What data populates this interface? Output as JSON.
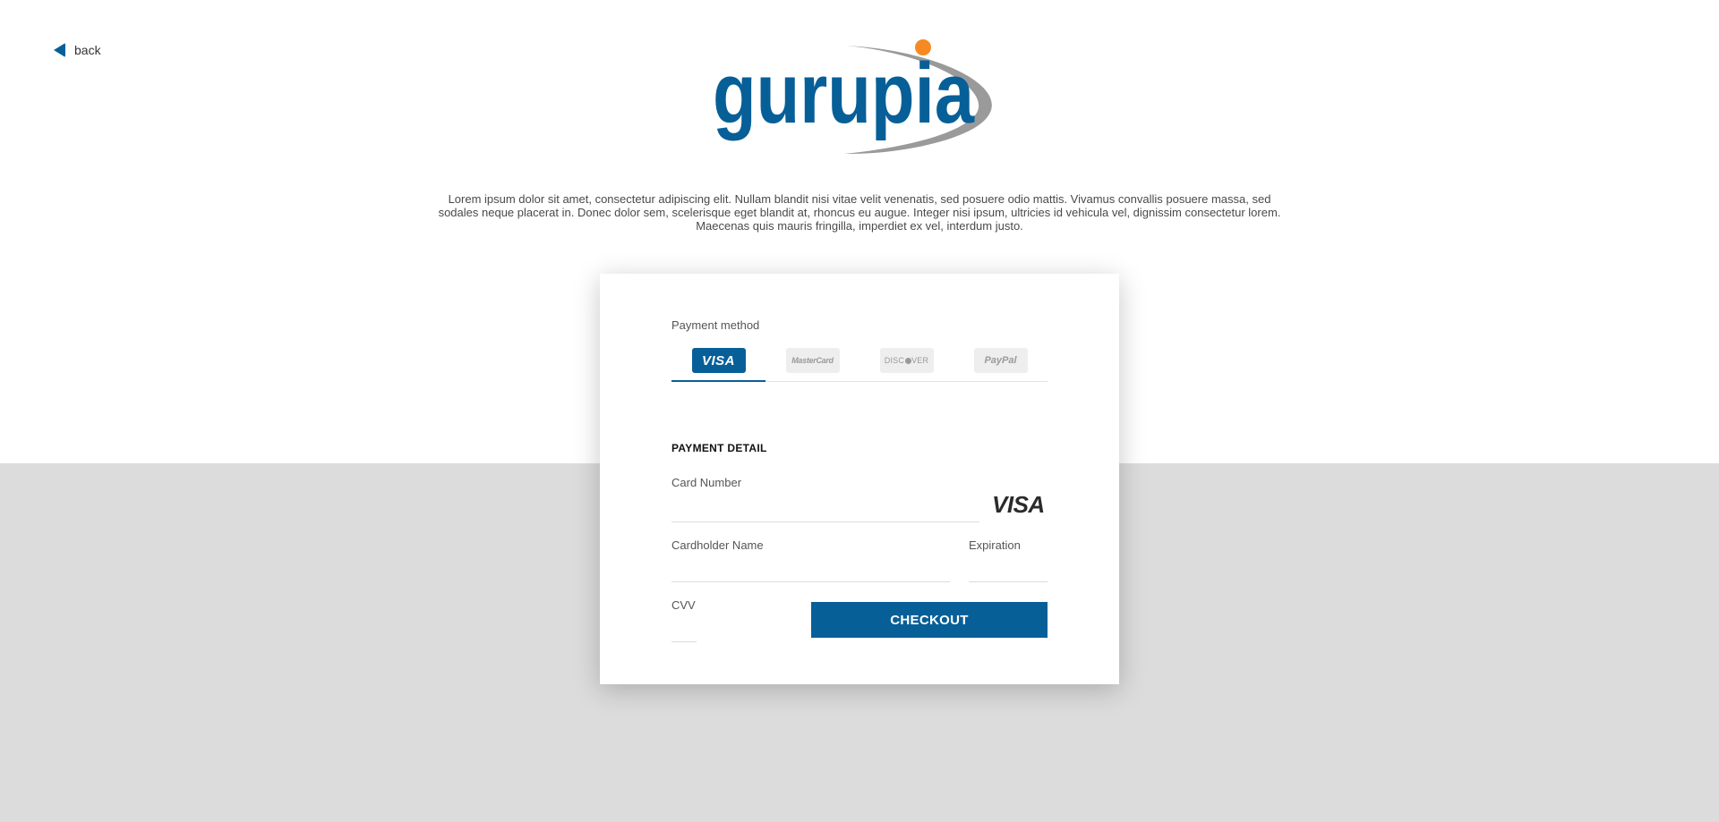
{
  "nav": {
    "back_label": "back"
  },
  "brand": {
    "logo_text": "gurupia",
    "primary_color": "#075f98",
    "accent_color": "#f58a25",
    "swoosh_color": "#9a9a9a"
  },
  "intro_text": "Lorem ipsum dolor sit amet, consectetur adipiscing elit. Nullam blandit nisi vitae velit venenatis, sed posuere odio mattis. Vivamus convallis posuere massa, sed sodales neque placerat in. Donec dolor sem, scelerisque eget blandit at, rhoncus eu augue. Integer nisi ipsum, ultricies id vehicula vel, dignissim consectetur lorem. Maecenas quis mauris fringilla, imperdiet ex vel, interdum justo.",
  "payment": {
    "method_label": "Payment method",
    "selected_method": "VISA",
    "methods": [
      {
        "label": "VISA",
        "icon": "visa-icon"
      },
      {
        "label": "MasterCard",
        "icon": "mastercard-icon"
      },
      {
        "label": "DISCOVER",
        "icon": "discover-icon"
      },
      {
        "label": "PayPal",
        "icon": "paypal-icon"
      }
    ],
    "detail_title": "PAYMENT DETAIL",
    "card_number_label": "Card Number",
    "card_number_value": "",
    "card_brand": "VISA",
    "cardholder_label": "Cardholder Name",
    "cardholder_value": "",
    "expiration_label": "Expiration",
    "expiration_value": "",
    "cvv_label": "CVV",
    "cvv_value": "",
    "checkout_label": "CHECKOUT"
  }
}
